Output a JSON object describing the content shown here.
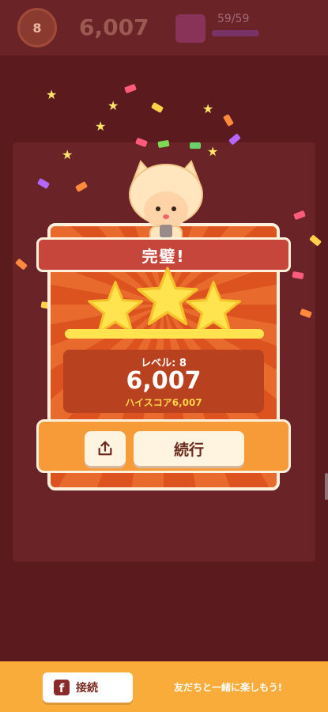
{
  "hud": {
    "level_number": "8",
    "score": "6,007",
    "moves": "59/59"
  },
  "result": {
    "title": "完璧!",
    "stars_earned": 3,
    "stars_total": 3,
    "level_label": "レベル: 8",
    "score": "6,007",
    "high_score_label": "ハイスコア6,007"
  },
  "actions": {
    "continue_label": "続行",
    "share_icon": "share-icon"
  },
  "footer": {
    "connect_label": "接続",
    "facebook_icon": "facebook-icon",
    "message": "友だちと一緒に楽しもう!"
  },
  "colors": {
    "background": "#5b1a1e",
    "panel": "#e25b25",
    "star": "#ffe44f",
    "footer": "#f9ac3a"
  }
}
